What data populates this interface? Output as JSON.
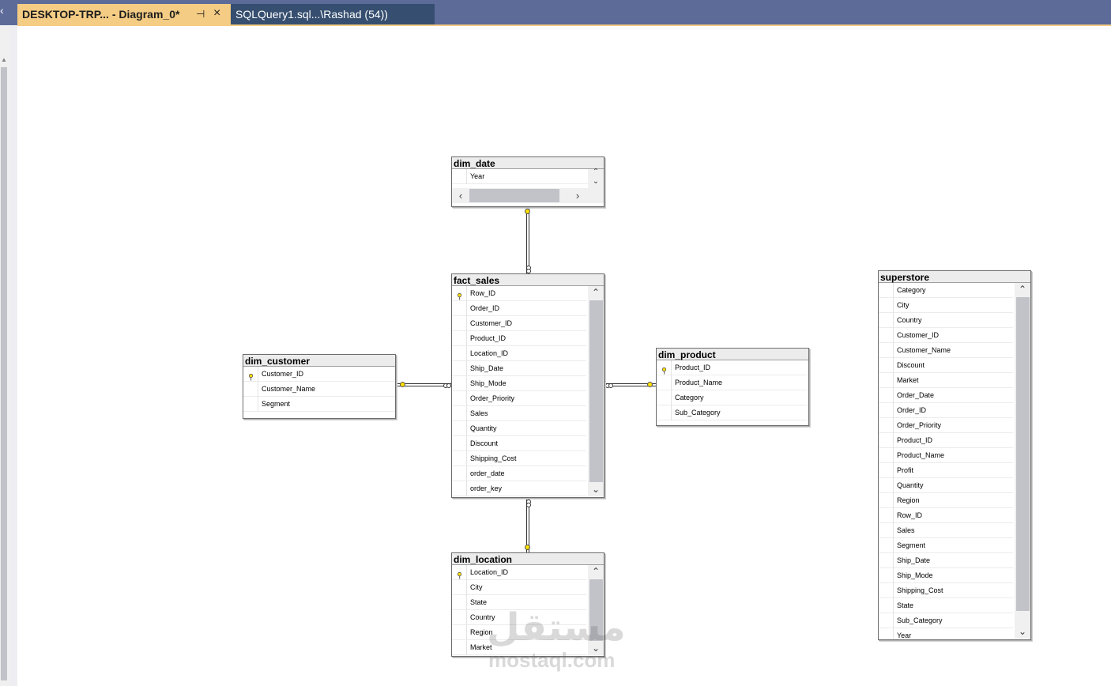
{
  "tabs": {
    "active_title": "DESKTOP-TRP... - Diagram_0*",
    "inactive_title": "SQLQuery1.sql...\\Rashad (54))"
  },
  "tables": {
    "dim_date": {
      "name": "dim_date",
      "columns": [
        "Year"
      ]
    },
    "fact_sales": {
      "name": "fact_sales",
      "columns": [
        "Row_ID",
        "Order_ID",
        "Customer_ID",
        "Product_ID",
        "Location_ID",
        "Ship_Date",
        "Ship_Mode",
        "Order_Priority",
        "Sales",
        "Quantity",
        "Discount",
        "Shipping_Cost",
        "order_date",
        "order_key"
      ]
    },
    "dim_customer": {
      "name": "dim_customer",
      "columns": [
        "Customer_ID",
        "Customer_Name",
        "Segment"
      ]
    },
    "dim_product": {
      "name": "dim_product",
      "columns": [
        "Product_ID",
        "Product_Name",
        "Category",
        "Sub_Category"
      ]
    },
    "dim_location": {
      "name": "dim_location",
      "columns": [
        "Location_ID",
        "City",
        "State",
        "Country",
        "Region",
        "Market"
      ]
    },
    "superstore": {
      "name": "superstore",
      "columns": [
        "Category",
        "City",
        "Country",
        "Customer_ID",
        "Customer_Name",
        "Discount",
        "Market",
        "Order_Date",
        "Order_ID",
        "Order_Priority",
        "Product_ID",
        "Product_Name",
        "Profit",
        "Quantity",
        "Region",
        "Row_ID",
        "Sales",
        "Segment",
        "Ship_Date",
        "Ship_Mode",
        "Shipping_Cost",
        "State",
        "Sub_Category",
        "Year"
      ]
    }
  },
  "icons": {
    "pin": "pin-icon",
    "close": "close-icon",
    "key": "primary-key-icon",
    "scroll_up": "chevron-up-icon",
    "scroll_down": "chevron-down-icon",
    "scroll_left": "chevron-left-icon",
    "scroll_right": "chevron-right-icon"
  },
  "colors": {
    "tab_strip": "#5d6b99",
    "active_tab": "#f5cc84",
    "inactive_tab": "#364e6f",
    "key_yellow": "#ffe000"
  },
  "watermark": {
    "arabic": "مستقل",
    "latin": "mostaql.com"
  }
}
